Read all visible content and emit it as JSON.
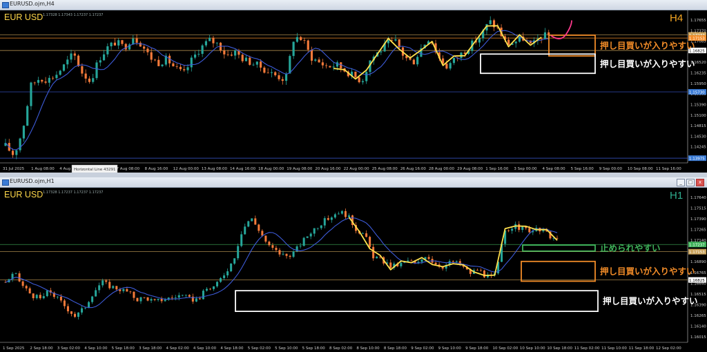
{
  "windows": [
    {
      "id": "h4",
      "window_title": "EURUSD.ojm,H4",
      "header_values": "1.17328 1.17343 1.17237 1.17237",
      "symbol_label": "EUR USD",
      "tf_label": "H4",
      "tooltip": {
        "title": "Horizontal Line 43291",
        "value": "1.13975"
      }
    },
    {
      "id": "h1",
      "window_title": "EURUSD.ojm,H1",
      "header_values": "1.17328 1.17237 1.17237 1.17237",
      "symbol_label": "EUR USD",
      "tf_label": "H1"
    }
  ],
  "window_buttons": {
    "minimize": "_",
    "maximize": "□",
    "close": "x"
  },
  "colors": {
    "bull": "#26a69a",
    "bear": "#f47a3a",
    "ma": "#3d5bd8",
    "zigzag": "#ffe14d",
    "pink": "#ff3a8c",
    "orange_box": "#f28c28",
    "green_box": "#3fb25a",
    "white_box": "#ffffff",
    "level_line": "#c9a25a",
    "blue_line": "#3d5bd8",
    "price_tag": "#3a7bd5"
  },
  "chart_data": [
    {
      "type": "candlestick",
      "title": "EUR USD",
      "timeframe": "H4",
      "ylim": [
        1.1385,
        1.1785
      ],
      "y_ticks": [
        "1.17655",
        "1.17370",
        "1.17085",
        "1.16805",
        "1.16520",
        "1.16235",
        "1.15950",
        "1.15665",
        "1.15390",
        "1.15100",
        "1.14815",
        "1.14530",
        "1.14245",
        "1.13960"
      ],
      "x_tick_labels": [
        "31 Jul 2025",
        "1 Aug 08:00",
        "4 Aug 16:00",
        "6 Aug 00:00",
        "7 Aug 08:00",
        "8 Aug 16:00",
        "12 Aug 00:00",
        "13 Aug 08:00",
        "14 Aug 16:00",
        "18 Aug 00:00",
        "19 Aug 08:00",
        "20 Aug 16:00",
        "22 Aug 00:00",
        "25 Aug 08:00",
        "26 Aug 16:00",
        "28 Aug 00:00",
        "29 Aug 08:00",
        "1 Sep 16:00",
        "3 Sep 00:00",
        "4 Sep 08:00",
        "5 Sep 16:00",
        "9 Sep 00:00",
        "10 Sep 08:00",
        "11 Sep 16:00"
      ],
      "price_tags": [
        {
          "value": 1.17237,
          "label": "1.17237",
          "style": "level"
        },
        {
          "value": 1.17153,
          "label": "1.17153",
          "style": "orange"
        },
        {
          "value": 1.16825,
          "label": "1.16825",
          "style": "white"
        },
        {
          "value": 1.1573,
          "label": "1.15730",
          "style": "blue"
        },
        {
          "value": 1.13975,
          "label": "1.13975",
          "style": "blue"
        }
      ],
      "zones": [
        {
          "label": "押し目買いが入りやすい",
          "color": "orange",
          "from": 1.1668,
          "to": 1.1723
        },
        {
          "label": "押し目買いが入りやすい",
          "color": "white",
          "from": 1.1622,
          "to": 1.1673
        }
      ],
      "trend": [
        1.143,
        1.1405,
        1.147,
        1.159,
        1.161,
        1.1605,
        1.162,
        1.1645,
        1.1675,
        1.1625,
        1.16,
        1.166,
        1.169,
        1.1705,
        1.169,
        1.172,
        1.17,
        1.1665,
        1.165,
        1.166,
        1.1635,
        1.162,
        1.166,
        1.169,
        1.171,
        1.17,
        1.167,
        1.168,
        1.166,
        1.165,
        1.164,
        1.1625,
        1.1615,
        1.1605,
        1.172,
        1.1712,
        1.1665,
        1.165,
        1.164,
        1.1645,
        1.163,
        1.1615,
        1.1602,
        1.166,
        1.168,
        1.17,
        1.1705,
        1.1665,
        1.165,
        1.169,
        1.172,
        1.1665,
        1.164,
        1.166,
        1.168,
        1.17,
        1.172,
        1.176,
        1.174,
        1.17,
        1.1705,
        1.1715,
        1.1692,
        1.172,
        1.1722
      ]
    },
    {
      "type": "candlestick",
      "title": "EUR USD",
      "timeframe": "H1",
      "ylim": [
        1.161,
        1.1788
      ],
      "y_ticks": [
        "1.17640",
        "1.17515",
        "1.17390",
        "1.17265",
        "1.17140",
        "1.17015",
        "1.16890",
        "1.16765",
        "1.16640",
        "1.16515",
        "1.16390",
        "1.16265",
        "1.16140",
        "1.16015"
      ],
      "x_tick_labels": [
        "1 Sep 2025",
        "2 Sep 18:00",
        "3 Sep 02:00",
        "4 Sep 10:00",
        "5 Sep 18:00",
        "3 Sep 18:00",
        "4 Sep 02:00",
        "4 Sep 10:00",
        "4 Sep 18:00",
        "5 Sep 02:00",
        "5 Sep 10:00",
        "5 Sep 18:00",
        "8 Sep 02:00",
        "8 Sep 10:00",
        "8 Sep 18:00",
        "9 Sep 02:00",
        "9 Sep 10:00",
        "9 Sep 18:00",
        "10 Sep 02:00",
        "10 Sep 10:00",
        "10 Sep 18:00",
        "11 Sep 02:00",
        "11 Sep 10:00",
        "11 Sep 18:00",
        "12 Sep 02:00"
      ],
      "price_tags": [
        {
          "value": 1.17237,
          "label": "1.17237",
          "style": "green"
        },
        {
          "value": 1.17153,
          "label": "1.17153",
          "style": "level"
        },
        {
          "value": 1.16825,
          "label": "1.16825",
          "style": "white"
        }
      ],
      "zones": [
        {
          "label": "止められやすい",
          "color": "green",
          "from": 1.1716,
          "to": 1.1723
        },
        {
          "label": "押し目買いが入りやすい",
          "color": "orange",
          "from": 1.1681,
          "to": 1.1704
        },
        {
          "label": "押し目買いが入りやすい",
          "color": "white",
          "from": 1.1646,
          "to": 1.167
        }
      ],
      "trend": [
        1.168,
        1.169,
        1.1675,
        1.1665,
        1.166,
        1.167,
        1.166,
        1.165,
        1.164,
        1.165,
        1.1668,
        1.168,
        1.1675,
        1.1672,
        1.1668,
        1.166,
        1.1662,
        1.1657,
        1.166,
        1.1662,
        1.1665,
        1.166,
        1.166,
        1.1672,
        1.1675,
        1.169,
        1.1705,
        1.174,
        1.1755,
        1.174,
        1.1722,
        1.1715,
        1.171,
        1.1715,
        1.1728,
        1.174,
        1.1748,
        1.1755,
        1.1762,
        1.1758,
        1.1742,
        1.1735,
        1.171,
        1.1705,
        1.1698,
        1.17,
        1.1705,
        1.17,
        1.1712,
        1.1702,
        1.1698,
        1.1704,
        1.17,
        1.169,
        1.1695,
        1.1685,
        1.1688,
        1.174,
        1.1745,
        1.1742,
        1.174,
        1.174,
        1.1735,
        1.1728
      ]
    }
  ]
}
